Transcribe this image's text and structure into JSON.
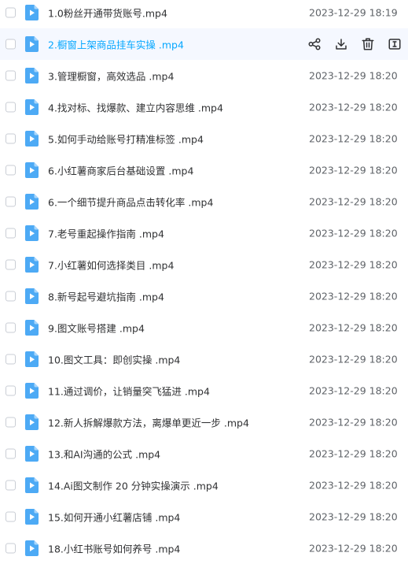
{
  "files": [
    {
      "name": "1.0粉丝开通带货账号.mp4",
      "date": "2023-12-29 18:19"
    },
    {
      "name": "2.橱窗上架商品挂车实操 .mp4",
      "date": "",
      "hover": true
    },
    {
      "name": "3.管理橱窗，高效选品 .mp4",
      "date": "2023-12-29 18:20"
    },
    {
      "name": "4.找对标、找爆款、建立内容思维 .mp4",
      "date": "2023-12-29 18:20"
    },
    {
      "name": "5.如何手动给账号打精准标签 .mp4",
      "date": "2023-12-29 18:20"
    },
    {
      "name": "6.小红薯商家后台基础设置 .mp4",
      "date": "2023-12-29 18:20"
    },
    {
      "name": "6.一个细节提升商品点击转化率 .mp4",
      "date": "2023-12-29 18:20"
    },
    {
      "name": "7.老号重起操作指南 .mp4",
      "date": "2023-12-29 18:20"
    },
    {
      "name": "7.小红薯如何选择类目 .mp4",
      "date": "2023-12-29 18:20"
    },
    {
      "name": "8.新号起号避坑指南 .mp4",
      "date": "2023-12-29 18:20"
    },
    {
      "name": "9.图文账号搭建 .mp4",
      "date": "2023-12-29 18:20"
    },
    {
      "name": "10.图文工具：即创实操 .mp4",
      "date": "2023-12-29 18:20"
    },
    {
      "name": "11.通过调价，让销量突飞猛进 .mp4",
      "date": "2023-12-29 18:20"
    },
    {
      "name": "12.新人拆解爆款方法，离爆单更近一步 .mp4",
      "date": "2023-12-29 18:20"
    },
    {
      "name": "13.和AI沟通的公式 .mp4",
      "date": "2023-12-29 18:20"
    },
    {
      "name": "14.Ai图文制作 20 分钟实操演示 .mp4",
      "date": "2023-12-29 18:20"
    },
    {
      "name": "15.如何开通小红薯店铺 .mp4",
      "date": "2023-12-29 18:20"
    },
    {
      "name": "18.小红书账号如何养号 .mp4",
      "date": "2023-12-29 18:20"
    }
  ],
  "hover_actions": [
    "share-icon",
    "download-icon",
    "delete-icon",
    "rename-icon"
  ],
  "colors": {
    "accent": "#06a7ff",
    "icon_blue": "#4daaf5",
    "hover_bg": "#f5f8ff"
  }
}
